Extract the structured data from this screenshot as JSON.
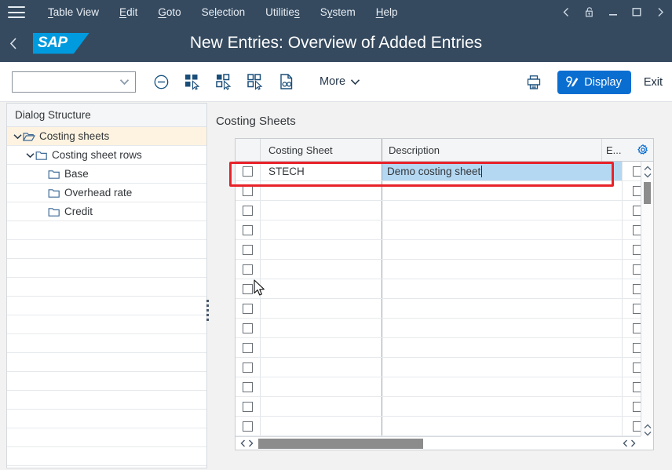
{
  "menubar": {
    "hamburger_label": "menu",
    "items": [
      {
        "label": "Table View",
        "accel": "T"
      },
      {
        "label": "Edit",
        "accel": "E"
      },
      {
        "label": "Goto",
        "accel": "G"
      },
      {
        "label": "Selection",
        "accel": "l"
      },
      {
        "label": "Utilities",
        "accel": "s"
      },
      {
        "label": "System",
        "accel": "y"
      },
      {
        "label": "Help",
        "accel": "H"
      }
    ],
    "window_controls": [
      "back",
      "lock",
      "minimize",
      "maximize",
      "close"
    ]
  },
  "shellbar": {
    "logo_text": "SAP",
    "title": "New Entries: Overview of Added Entries",
    "back_icon": "chevron-left-icon"
  },
  "toolbar": {
    "combo_value": "",
    "combo_placeholder": "",
    "icons": [
      "delete-row-icon",
      "select-all-icon",
      "select-block-icon",
      "deselect-all-icon",
      "document-search-icon"
    ],
    "more_label": "More",
    "print_icon": "printer-icon",
    "display_label": "Display",
    "display_icon": "edit-pencil-icon",
    "exit_label": "Exit"
  },
  "sidebar": {
    "header": "Dialog Structure",
    "tree": [
      {
        "label": "Costing sheets",
        "level": 0,
        "expanded": true,
        "selected": true,
        "icon": "open-folder-icon"
      },
      {
        "label": "Costing sheet rows",
        "level": 1,
        "expanded": true,
        "selected": false,
        "icon": "folder-icon"
      },
      {
        "label": "Base",
        "level": 2,
        "expanded": null,
        "selected": false,
        "icon": "folder-icon"
      },
      {
        "label": "Overhead rate",
        "level": 2,
        "expanded": null,
        "selected": false,
        "icon": "folder-icon"
      },
      {
        "label": "Credit",
        "level": 2,
        "expanded": null,
        "selected": false,
        "icon": "folder-icon"
      }
    ],
    "empty_row_count": 13
  },
  "main": {
    "section_title": "Costing Sheets",
    "table": {
      "columns": [
        {
          "key": "select",
          "label": ""
        },
        {
          "key": "costing_sheet",
          "label": "Costing Sheet"
        },
        {
          "key": "description",
          "label": "Description"
        },
        {
          "key": "e_col",
          "label": "E..."
        }
      ],
      "settings_icon": "gear-icon",
      "rows": [
        {
          "costing_sheet": "STECH",
          "description": "Demo costing sheet",
          "editing": true,
          "selected": false,
          "e_checked": false
        }
      ],
      "empty_row_count": 13
    },
    "scroll": {
      "vertical_thumb_pct": 8,
      "horizontal_thumb_pct": 40
    }
  },
  "annotation": {
    "highlight_color": "#e8232a",
    "highlight_target": "first-table-row"
  },
  "colors": {
    "shell_bg": "#354a5f",
    "accent": "#0a6ed1",
    "logo_blue": "#009ade",
    "selected_row_bg": "#fdf3e0",
    "edit_cell_bg": "#b5d8f2"
  }
}
